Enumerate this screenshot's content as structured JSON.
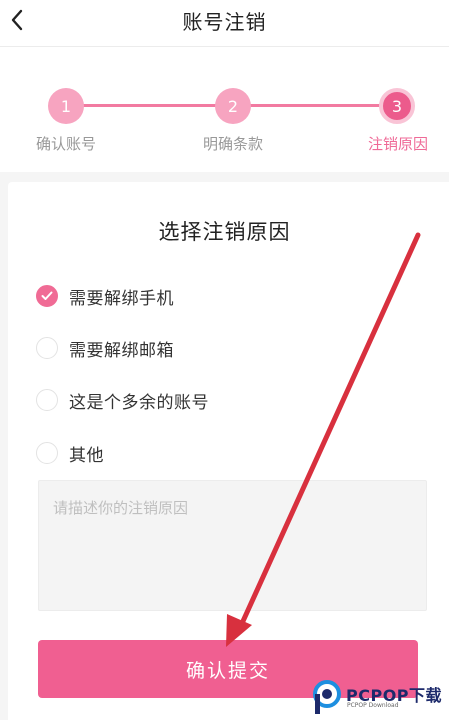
{
  "header": {
    "title": "账号注销",
    "back_icon": "chevron-left-icon"
  },
  "steps": [
    {
      "number": "1",
      "label": "确认账号",
      "active": false
    },
    {
      "number": "2",
      "label": "明确条款",
      "active": false
    },
    {
      "number": "3",
      "label": "注销原因",
      "active": true
    }
  ],
  "section_title": "选择注销原因",
  "options": [
    {
      "label": "需要解绑手机",
      "checked": true
    },
    {
      "label": "需要解绑邮箱",
      "checked": false
    },
    {
      "label": "这是个多余的账号",
      "checked": false
    },
    {
      "label": "其他",
      "checked": false
    }
  ],
  "reason_input": {
    "placeholder": "请描述你的注销原因",
    "value": ""
  },
  "submit_label": "确认提交",
  "watermark": {
    "brand": "PCPOP下载",
    "sub": "PCPOP Download"
  },
  "colors": {
    "accent": "#f05f91",
    "step_inactive": "#f7a4c0",
    "annotation_arrow": "#d8303e"
  }
}
